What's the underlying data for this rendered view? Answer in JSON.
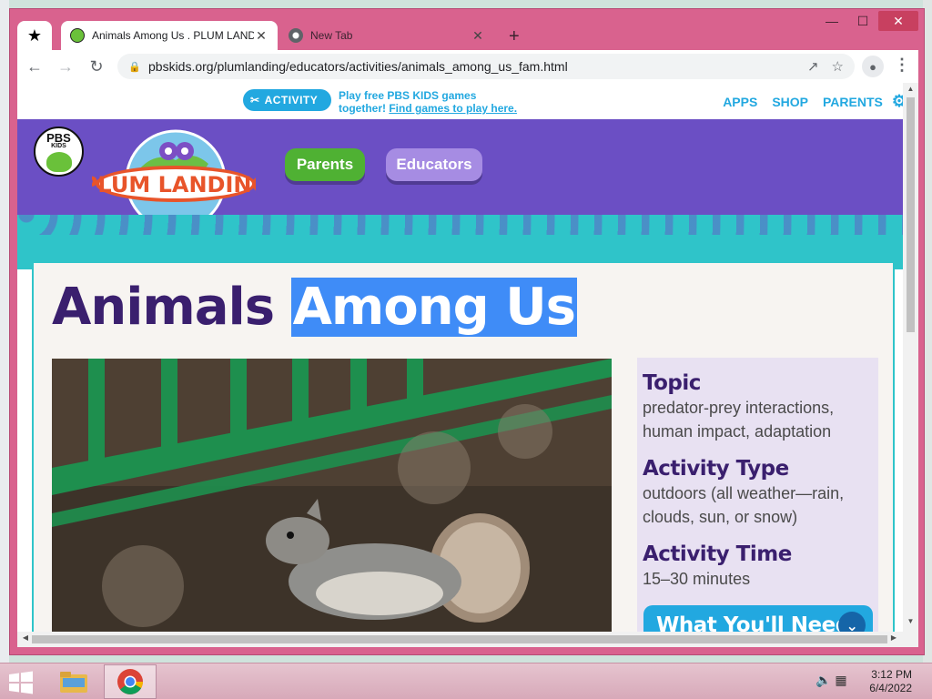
{
  "browser": {
    "tabs": [
      {
        "title": "Animals Among Us . PLUM LANDING",
        "active": true
      },
      {
        "title": "New Tab",
        "active": false
      }
    ],
    "url": "pbskids.org/plumlanding/educators/activities/animals_among_us_fam.html"
  },
  "topbar": {
    "activity_label": "ACTIVITY",
    "promo_line1": "Play free PBS KIDS games",
    "promo_line2": "together!",
    "promo_link": "Find games to play here.",
    "links": [
      "APPS",
      "SHOP",
      "PARENTS"
    ]
  },
  "header": {
    "pbs_logo_text": "PBS",
    "pbs_logo_sub": "KIDS",
    "plum_logo_text": "PLUM LANDING",
    "nav": [
      "Parents",
      "Educators"
    ]
  },
  "main": {
    "title_plain": "Animals",
    "title_selected": "Among Us",
    "sidebar": [
      {
        "heading": "Topic",
        "text": "predator-prey interactions, human impact, adaptation"
      },
      {
        "heading": "Activity Type",
        "text": "outdoors (all weather—rain, clouds, sun, or snow)"
      },
      {
        "heading": "Activity Time",
        "text": "15–30 minutes"
      }
    ],
    "need_button": "What You'll Need"
  },
  "taskbar": {
    "time": "3:12 PM",
    "date": "6/4/2022"
  },
  "colors": {
    "window_frame": "#d9628e",
    "pbs_purple": "#6b4fc4",
    "teal": "#2fc4c9",
    "accent_blue": "#22a8e0",
    "title_purple": "#3a1f6e",
    "parents_green": "#4fb133"
  }
}
